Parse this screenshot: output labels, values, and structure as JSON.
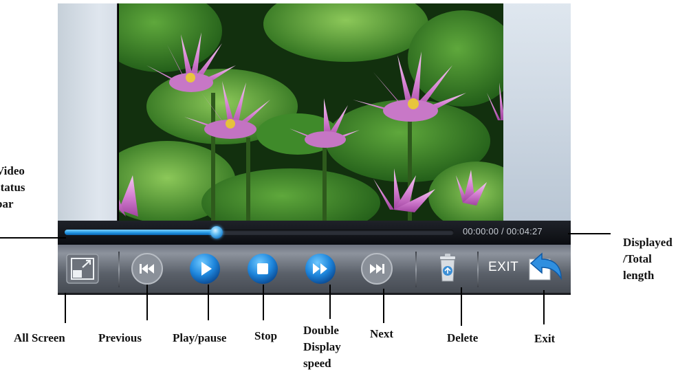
{
  "player": {
    "progress_fraction": 0.39,
    "time_readout": "00:00:00 / 00:04:27",
    "exit_label": "EXIT"
  },
  "icons": {
    "all_screen": "fullscreen-icon",
    "previous": "previous-track-icon",
    "play_pause": "play-icon",
    "stop": "stop-icon",
    "double_speed": "fast-forward-icon",
    "next": "next-track-icon",
    "delete": "trash-icon",
    "exit": "exit-arrow-icon"
  },
  "colors": {
    "accent_blue": "#1e92e0",
    "control_bar": "#5a6069"
  },
  "callouts": {
    "video_status_bar": [
      "Video",
      "status",
      "bar"
    ],
    "displayed_total_length": [
      "Displayed",
      "/Total",
      "length"
    ],
    "all_screen": "All Screen",
    "previous": "Previous",
    "play_pause": "Play/pause",
    "stop": "Stop",
    "double_display_speed": [
      "Double",
      "Display",
      "speed"
    ],
    "next": "Next",
    "delete": "Delete",
    "exit": "Exit"
  }
}
